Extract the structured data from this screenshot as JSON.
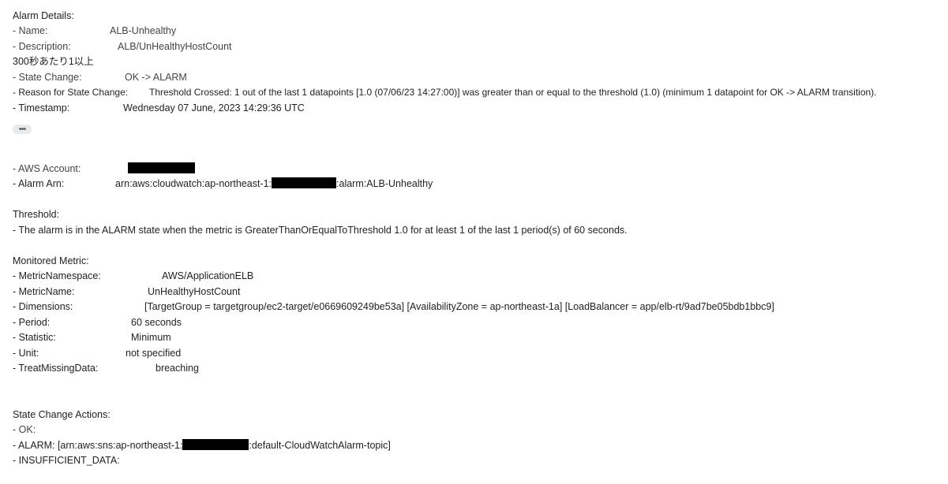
{
  "alarm_details": {
    "heading": "Alarm Details:",
    "name_label": "- Name:",
    "name_value": "ALB-Unhealthy",
    "description_label": "- Description:",
    "description_value": "ALB/UnHealthyHostCount",
    "description_extra": "300秒あたり1以上",
    "state_change_label": "- State Change:",
    "state_change_value": "OK -> ALARM",
    "reason_label": "- Reason for State Change:",
    "reason_value": "Threshold Crossed: 1 out of the last 1 datapoints [1.0 (07/06/23 14:27:00)] was greater than or equal to the threshold (1.0) (minimum 1 datapoint for OK -> ALARM transition).",
    "timestamp_label": "- Timestamp:",
    "timestamp_value": "Wednesday 07 June, 2023 14:29:36 UTC"
  },
  "more_button": {
    "label": "•••"
  },
  "account": {
    "aws_account_label": "- AWS Account:",
    "alarm_arn_label": "- Alarm Arn:",
    "alarm_arn_prefix": "arn:aws:cloudwatch:ap-northeast-1:",
    "alarm_arn_suffix": ":alarm:ALB-Unhealthy"
  },
  "threshold": {
    "heading": "Threshold:",
    "text": "- The alarm is in the ALARM state when the metric is GreaterThanOrEqualToThreshold 1.0 for at least 1 of the last 1 period(s) of 60 seconds."
  },
  "metric": {
    "heading": "Monitored Metric:",
    "namespace_label": "- MetricNamespace:",
    "namespace_value": "AWS/ApplicationELB",
    "name_label": "- MetricName:",
    "name_value": "UnHealthyHostCount",
    "dimensions_label": "- Dimensions:",
    "dimensions_value": "[TargetGroup = targetgroup/ec2-target/e0669609249be53a] [AvailabilityZone = ap-northeast-1a] [LoadBalancer = app/elb-rt/9ad7be05bdb1bbc9]",
    "period_label": "- Period:",
    "period_value": "60 seconds",
    "statistic_label": "- Statistic:",
    "statistic_value": "Minimum",
    "unit_label": "- Unit:",
    "unit_value": "not specified",
    "treat_missing_label": "- TreatMissingData:",
    "treat_missing_value": "breaching"
  },
  "actions": {
    "heading": "State Change Actions:",
    "ok_label": "- OK:",
    "alarm_prefix": "- ALARM: [arn:aws:sns:ap-northeast-1:",
    "alarm_suffix": ":default-CloudWatchAlarm-topic]",
    "insufficient_label": "- INSUFFICIENT_DATA:"
  }
}
